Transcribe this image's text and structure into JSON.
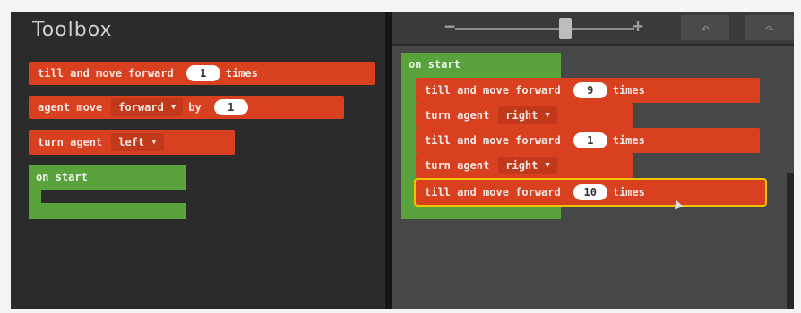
{
  "toolbox": {
    "title": "Toolbox",
    "blocks": [
      {
        "text": "till and move forward",
        "value": "1",
        "suffix": "times"
      },
      {
        "text": "agent move",
        "dropdown": "forward",
        "by": "by",
        "value": "1"
      },
      {
        "text": "turn agent",
        "dropdown": "left"
      },
      {
        "text": "on start"
      }
    ]
  },
  "workspace": {
    "zoom": {
      "minus": "−",
      "plus": "+"
    },
    "undo": "↶",
    "redo": "↷",
    "on_start": "on start",
    "blocks": [
      {
        "text": "till and move forward",
        "value": "9",
        "suffix": "times"
      },
      {
        "text": "turn agent",
        "dropdown": "right"
      },
      {
        "text": "till and move forward",
        "value": "1",
        "suffix": "times"
      },
      {
        "text": "turn agent",
        "dropdown": "right"
      },
      {
        "text": "till and move forward",
        "value": "10",
        "suffix": "times"
      }
    ]
  },
  "colors": {
    "block_red": "#d9401f",
    "block_green": "#5aa23b",
    "selected_outline": "#f2c200",
    "toolbox_bg": "#2b2b2b",
    "workspace_bg": "#474747"
  },
  "icons": {
    "dropdown": "chevron-down-icon",
    "cursor": "pointer-cursor-icon"
  }
}
